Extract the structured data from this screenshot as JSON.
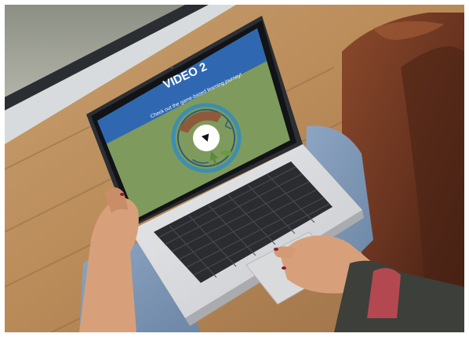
{
  "video_screen": {
    "title": "VIDEO 2",
    "subtitle": "Check out the game-based learning journey!",
    "play_icon": "play-triangle-icon"
  },
  "colors": {
    "banner_blue": "#2f67b1",
    "screen_green": "#7f9a5d",
    "play_button_white": "#ffffff"
  }
}
